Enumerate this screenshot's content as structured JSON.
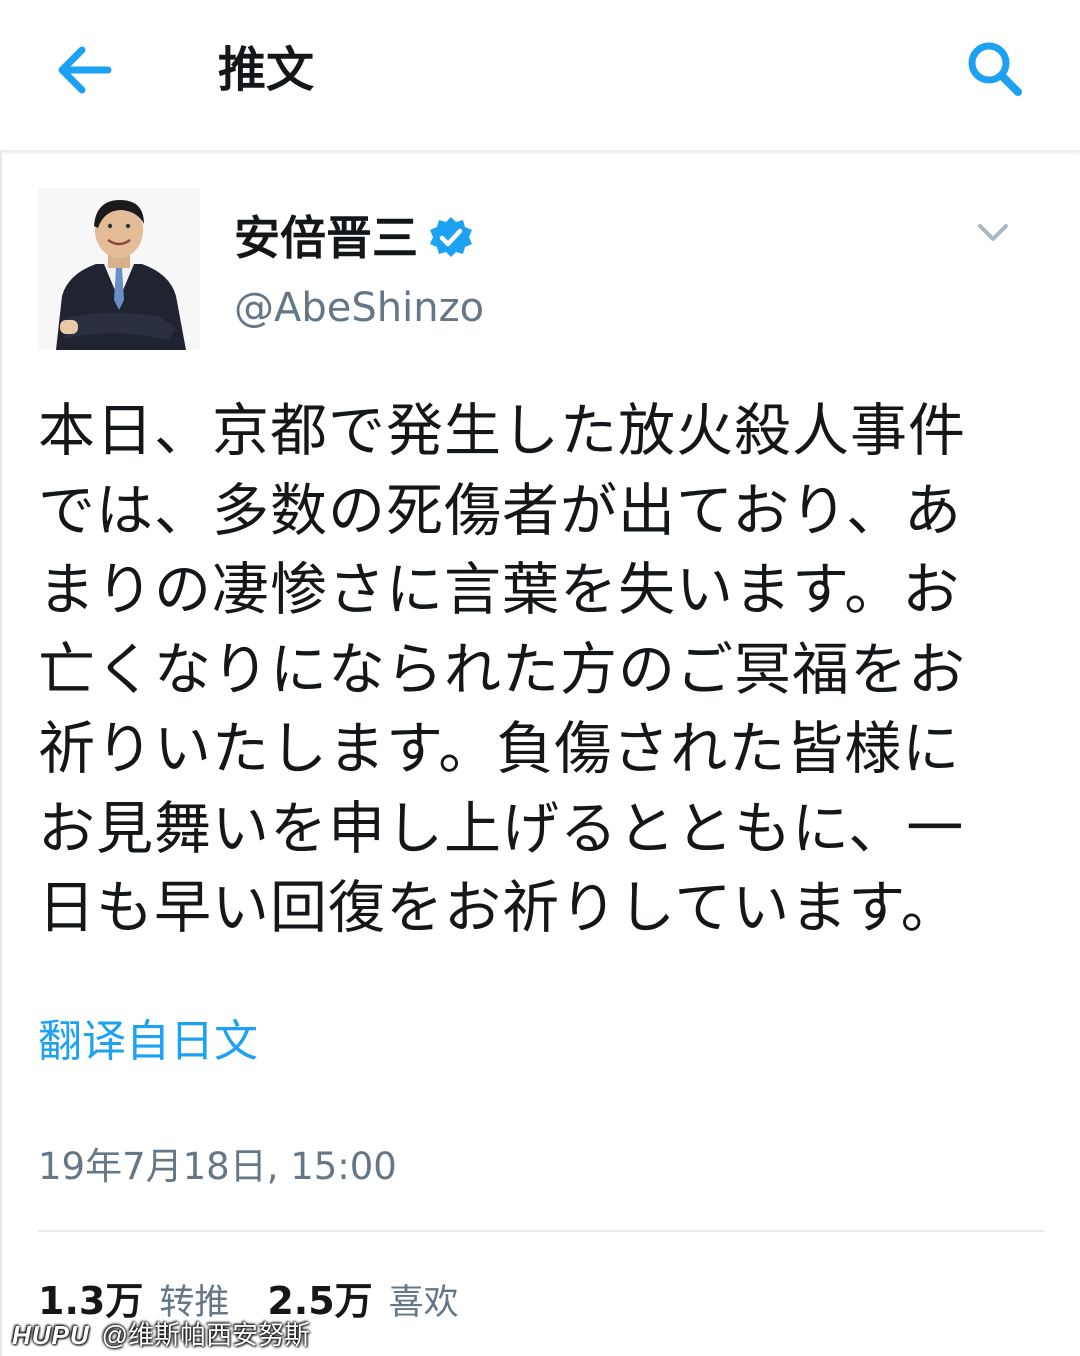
{
  "header": {
    "back_icon": "arrow-left-icon",
    "title": "推文",
    "search_icon": "search-icon"
  },
  "tweet": {
    "author": {
      "display_name": "安倍晋三",
      "handle": "@AbeShinzo",
      "verified": true
    },
    "menu_icon": "chevron-down-icon",
    "text_lines": [
      "本日、京都で発生した放火殺人事件",
      "では、多数の死傷者が出ており、あ",
      "まりの凄惨さに言葉を失います。お",
      "亡くなりになられた方のご冥福をお",
      "祈りいたします。負傷された皆様に",
      "お見舞いを申し上げるとともに、一",
      "日も早い回復をお祈りしています。"
    ],
    "translate_label": "翻译自日文",
    "timestamp": "19年7月18日, 15:00",
    "stats": {
      "retweets_count": "1.3万",
      "retweets_label": "转推",
      "likes_count": "2.5万",
      "likes_label": "喜欢"
    }
  },
  "watermark": {
    "logo": "HUPU",
    "text": "@维斯帕西安努斯"
  },
  "colors": {
    "accent": "#1da1f2",
    "secondary_text": "#657786",
    "primary_text": "#14171a",
    "divider": "#e6ecf0"
  }
}
